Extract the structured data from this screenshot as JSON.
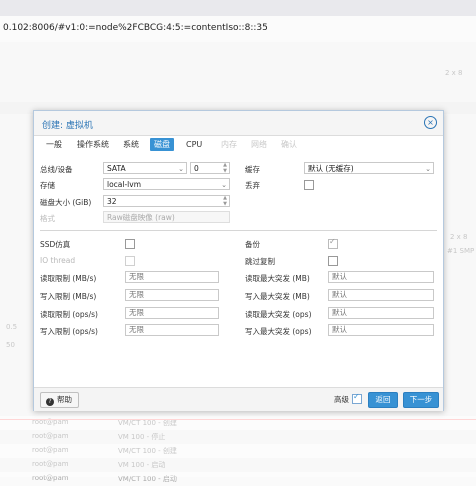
{
  "browser": {
    "url": "0.102:8006/#v1:0:=node%2FCBCG:4:5:=contentIso::8::35"
  },
  "background": {
    "tasks": [
      {
        "user": "root@pam",
        "desc": "VM/CT 100 - 创建"
      },
      {
        "user": "root@pam",
        "desc": "VM 100 - 停止"
      },
      {
        "user": "root@pam",
        "desc": "VM/CT 100 - 创建"
      },
      {
        "user": "root@pam",
        "desc": "VM 100 - 启动"
      },
      {
        "user": "root@pam",
        "desc": "VM/CT 100 - 启动"
      }
    ],
    "side_labels": [
      "2 x 8",
      "#1 SMP",
      "0.5",
      "50"
    ]
  },
  "dialog": {
    "title": "创建: 虚拟机",
    "tabs": [
      {
        "label": "一般"
      },
      {
        "label": "操作系统"
      },
      {
        "label": "系统"
      },
      {
        "label": "磁盘"
      },
      {
        "label": "CPU"
      },
      {
        "label": "内存"
      },
      {
        "label": "网络"
      },
      {
        "label": "确认"
      }
    ],
    "disk": {
      "bus_label": "总线/设备",
      "bus_value": "SATA",
      "bus_index": "0",
      "storage_label": "存储",
      "storage_value": "local-lvm",
      "size_label": "磁盘大小 (GiB)",
      "size_value": "32",
      "format_label": "格式",
      "format_value": "Raw磁盘映像 (raw)",
      "cache_label": "缓存",
      "cache_value": "默认 (无缓存)",
      "discard_label": "丢弃"
    },
    "advanced": {
      "ssd_label": "SSD仿真",
      "iothread_label": "IO thread",
      "backup_label": "备份",
      "skip_replication_label": "跳过复制",
      "rows": [
        {
          "left_label": "读取限制 (MB/s)",
          "left_ph": "无限",
          "right_label": "读取最大突发 (MB)",
          "right_ph": "默认"
        },
        {
          "left_label": "写入限制 (MB/s)",
          "left_ph": "无限",
          "right_label": "写入最大突发 (MB)",
          "right_ph": "默认"
        },
        {
          "left_label": "读取限制 (ops/s)",
          "left_ph": "无限",
          "right_label": "读取最大突发 (ops)",
          "right_ph": "默认"
        },
        {
          "left_label": "写入限制 (ops/s)",
          "left_ph": "无限",
          "right_label": "写入最大突发 (ops)",
          "right_ph": "默认"
        }
      ]
    },
    "footer": {
      "help": "帮助",
      "advanced": "高级",
      "back": "返回",
      "next": "下一步"
    }
  }
}
